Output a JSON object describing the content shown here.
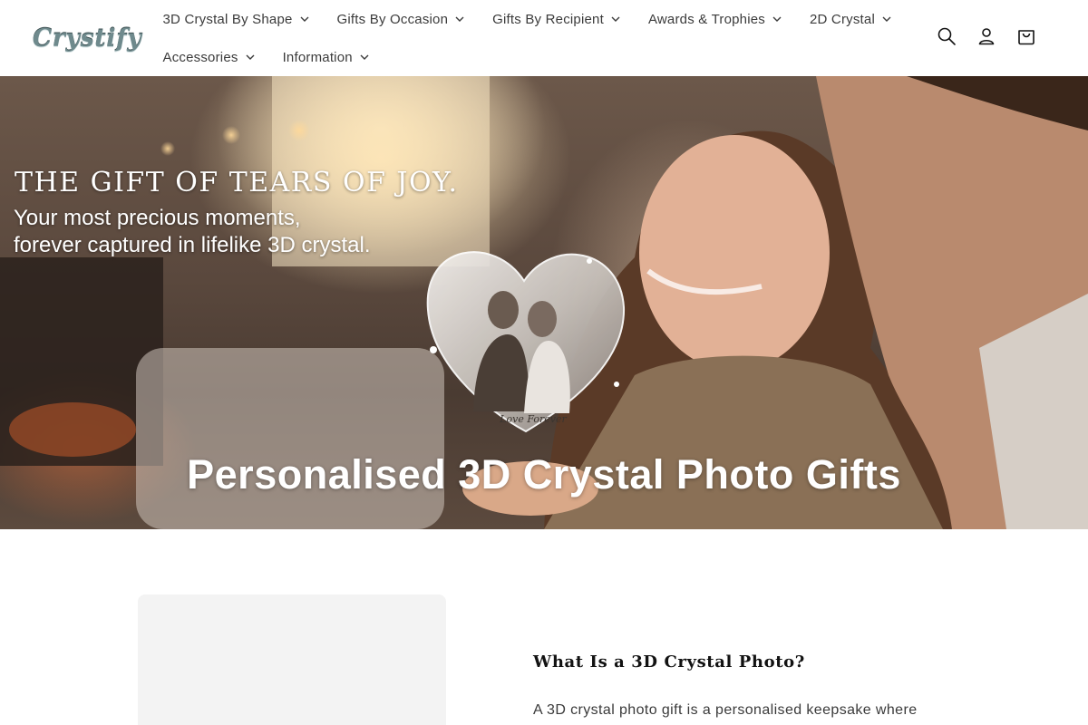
{
  "header": {
    "logo_text": "Crystify",
    "nav": {
      "row1": [
        {
          "label": "3D Crystal By Shape"
        },
        {
          "label": "Gifts By Occasion"
        },
        {
          "label": "Gifts By Recipient"
        },
        {
          "label": "Awards & Trophies"
        },
        {
          "label": "2D Crystal"
        }
      ],
      "row2": [
        {
          "label": "Accessories"
        },
        {
          "label": "Information"
        }
      ]
    },
    "icons": [
      "search-icon",
      "account-icon",
      "cart-icon"
    ]
  },
  "hero": {
    "headline": "THE GIFT OF TEARS OF JOY.",
    "subline_1": "Your most precious moments,",
    "subline_2": "forever captured in lifelike 3D crystal.",
    "crystal_engraving": "Love Forever",
    "title": "Personalised 3D Crystal Photo Gifts"
  },
  "intro": {
    "heading": "What Is a 3D Crystal Photo?",
    "text": "A 3D crystal photo gift is a personalised keepsake where"
  },
  "colors": {
    "nav_text": "#3b3b3b",
    "hero_text": "#ffffff",
    "placeholder_bg": "#f3f3f3",
    "body_text": "#3a3a3a"
  }
}
